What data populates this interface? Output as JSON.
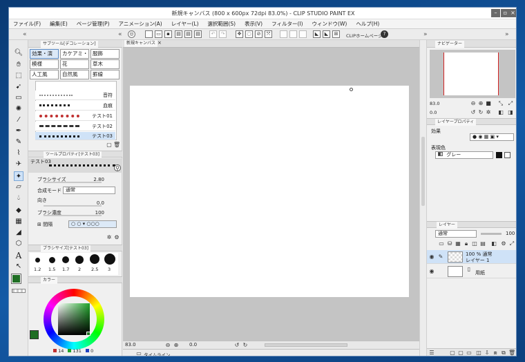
{
  "window": {
    "title": "新規キャンバス (800 x 600px 72dpi 83.0%) - CLIP STUDIO PAINT EX"
  },
  "menu": [
    "ファイル(F)",
    "編集(E)",
    "ページ管理(P)",
    "アニメーション(A)",
    "レイヤー(L)",
    "選択範囲(S)",
    "表示(V)",
    "フィルター(I)",
    "ウィンドウ(W)",
    "ヘルプ(H)"
  ],
  "cmdbar": {
    "home_label": "CLIPホームページ"
  },
  "subtool": {
    "tab": "サブツール[デコレーション]",
    "groups": [
      "効果・演",
      "カケアミ・",
      "服飾",
      "模様",
      "花",
      "草木",
      "人工風",
      "自然風",
      "罫線"
    ],
    "brushes": [
      "音符",
      "血痕",
      "テスト01",
      "テスト02",
      "テスト03"
    ]
  },
  "toolprop": {
    "tab": "ツールプロパティ[テスト03]",
    "preview_name": "テスト03",
    "brush_size_label": "ブラシサイズ",
    "brush_size_value": "2.80",
    "blend_label": "合成モード",
    "blend_value": "通常",
    "direction_label": "向き",
    "direction_value": "0.0",
    "density_label": "ブラシ濃度",
    "density_value": "100",
    "spacing_label": "間隔"
  },
  "brushsize": {
    "tab": "ブラシサイズ[テスト03]",
    "sizes": [
      "1.2",
      "1.5",
      "1.7",
      "2",
      "2.5",
      "3"
    ]
  },
  "color": {
    "tab": "カラー",
    "main": "#1f6e24",
    "h": "14",
    "s": "131",
    "v": "0"
  },
  "canvas": {
    "tab": "新規キャンバス",
    "zoom": "83.0",
    "angle": "0.0",
    "timeline_label": "タイムライン"
  },
  "navigator": {
    "tab": "ナビゲーター",
    "zoom": "83.0",
    "angle": "0.0"
  },
  "layerprop": {
    "tab": "レイヤープロパティ",
    "effect_label": "効果",
    "color_label": "表現色",
    "color_value": "グレー"
  },
  "layers": {
    "tab": "レイヤー",
    "blend": "通常",
    "opacity": "100",
    "items": [
      {
        "opacity_label": "100 % 通常",
        "name": "レイヤー 1"
      },
      {
        "name": "用紙"
      }
    ]
  }
}
